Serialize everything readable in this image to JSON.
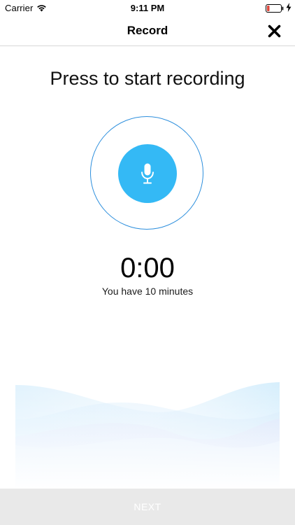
{
  "status_bar": {
    "carrier": "Carrier",
    "time": "9:11 PM",
    "wifi_icon": "wifi-icon",
    "battery_icon": "battery-low-icon",
    "charging_icon": "charging-bolt-icon",
    "battery_color": "#e0463a"
  },
  "nav": {
    "title": "Record",
    "close_icon": "close-icon"
  },
  "main": {
    "headline": "Press to start recording",
    "mic_icon": "microphone-icon",
    "timer": "0:00",
    "time_limit": "You have 10 minutes"
  },
  "footer": {
    "next_label": "NEXT"
  },
  "colors": {
    "accent": "#34b9f5",
    "ring": "#2d8fdd",
    "footer_bg": "#e9e9e9"
  }
}
